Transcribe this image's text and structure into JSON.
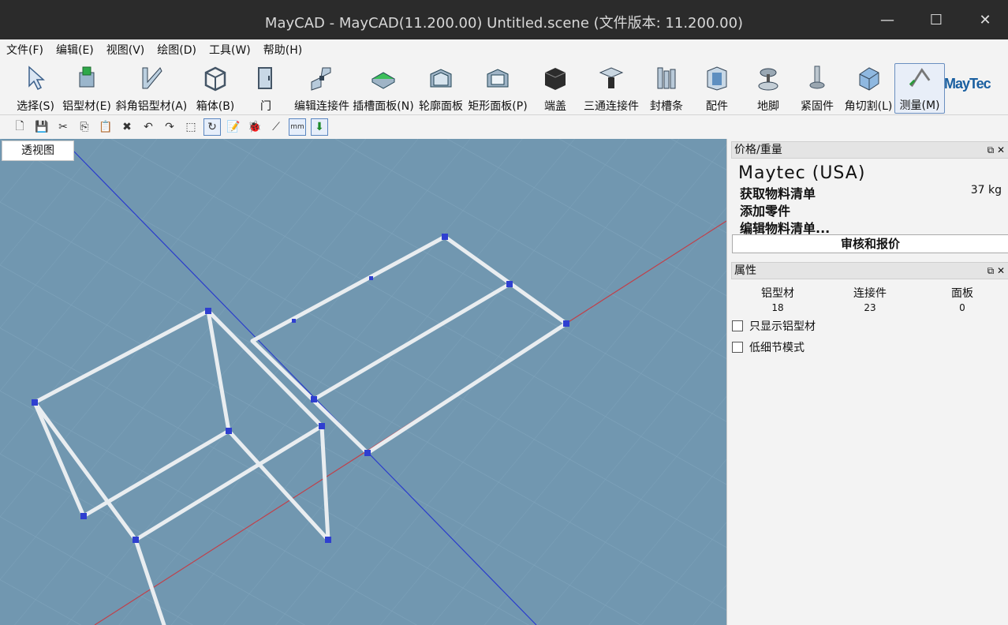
{
  "window": {
    "title": "MayCAD - MayCAD(11.200.00) Untitled.scene (文件版本: 11.200.00)"
  },
  "menu": [
    "文件(F)",
    "编辑(E)",
    "视图(V)",
    "绘图(D)",
    "工具(W)",
    "帮助(H)"
  ],
  "tools": [
    {
      "label": "选择(S)",
      "icon": "cursor-icon"
    },
    {
      "label": "铝型材(E)",
      "icon": "profile-icon"
    },
    {
      "label": "斜角铝型材(A)",
      "icon": "miter-profile-icon"
    },
    {
      "label": "箱体(B)",
      "icon": "box-icon"
    },
    {
      "label": "门",
      "icon": "door-icon"
    },
    {
      "label": "编辑连接件",
      "icon": "connector-edit-icon"
    },
    {
      "label": "插槽面板(N)",
      "icon": "slot-panel-icon"
    },
    {
      "label": "轮廓面板",
      "icon": "contour-panel-icon"
    },
    {
      "label": "矩形面板(P)",
      "icon": "rect-panel-icon"
    },
    {
      "label": "端盖",
      "icon": "end-cap-icon"
    },
    {
      "label": "三通连接件",
      "icon": "tee-connector-icon"
    },
    {
      "label": "封槽条",
      "icon": "slot-cover-icon"
    },
    {
      "label": "配件",
      "icon": "accessory-icon"
    },
    {
      "label": "地脚",
      "icon": "foot-icon"
    },
    {
      "label": "紧固件",
      "icon": "fastener-icon"
    },
    {
      "label": "角切割(L)",
      "icon": "angle-cut-icon"
    },
    {
      "label": "测量(M)",
      "icon": "measure-icon"
    }
  ],
  "brand": "MayTec",
  "unit_button": "mm",
  "viewport": {
    "tab": "透视图"
  },
  "price_panel": {
    "title": "价格/重量",
    "company": "Maytec (USA)",
    "get_bom": "获取物料清单",
    "weight": "37 kg",
    "add_part": "添加零件",
    "edit_bom": "编辑物料清单...",
    "quote_button": "审核和报价"
  },
  "props_panel": {
    "title": "属性",
    "stats": [
      {
        "label": "铝型材",
        "value": "18"
      },
      {
        "label": "连接件",
        "value": "23"
      },
      {
        "label": "面板",
        "value": "0"
      }
    ],
    "only_profiles": "只显示铝型材",
    "low_detail": "低细节模式"
  },
  "colors": {
    "viewport_bg": "#7197b0",
    "axis_blue": "#2a3ccc",
    "axis_red": "#c0404a",
    "profile": "#e9edf0",
    "connector": "#2f3fd0"
  }
}
